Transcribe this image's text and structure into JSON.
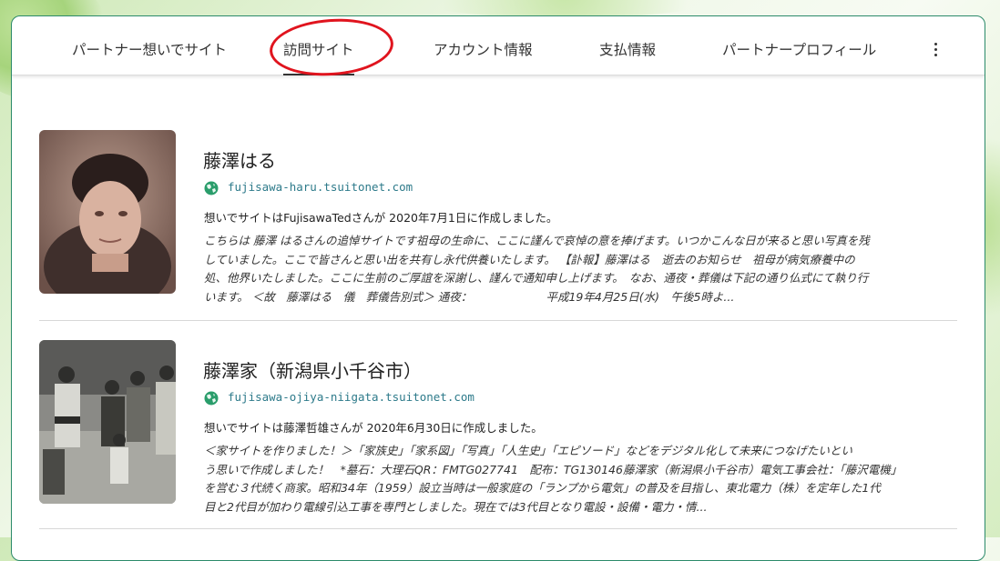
{
  "nav": {
    "tabs": [
      {
        "label": "パートナー想いでサイト"
      },
      {
        "label": "訪問サイト"
      },
      {
        "label": "アカウント情報"
      },
      {
        "label": "支払情報"
      },
      {
        "label": "パートナープロフィール"
      }
    ],
    "active_index": 1
  },
  "entries": [
    {
      "name": "藤澤はる",
      "url": "fujisawa-haru.tsuitonet.com",
      "meta": "想いでサイトはFujisawaTedさんが 2020年7月1日に作成しました。",
      "desc": [
        "こちらは 藤澤 はるさんの追悼サイトです祖母の生命に、ここに謹んで哀悼の意を捧げます。いつかこんな日が来ると思い写真を残",
        "していました。ここで皆さんと思い出を共有し永代供養いたします。 【訃報】藤澤はる　逝去のお知らせ　祖母が病気療養中の",
        "処、他界いたしました。ここに生前のご厚誼を深謝し、謹んで通知申し上げます。　なお、通夜・葬儀は下記の通り仏式にて執り行",
        "います。 ＜故　藤澤はる　儀　葬儀告別式＞ 通夜：　　　　　　　平成19年4月25日(水)　午後5時よ..."
      ]
    },
    {
      "name": "藤澤家（新潟県小千谷市）",
      "url": "fujisawa-ojiya-niigata.tsuitonet.com",
      "meta": "想いでサイトは藤澤哲雄さんが 2020年6月30日に作成しました。",
      "desc": [
        "＜家サイトを作りました！＞「家族史」「家系図」「写真」「人生史」「エピソード」などをデジタル化して未来につなげたいとい",
        "う思いで作成しました！　*墓石：大理石QR：FMTG027741　配布：TG130146藤澤家（新潟県小千谷市）電気工事会社：「藤沢電機」",
        "を営む３代続く商家。昭和34年（1959）設立当時は一般家庭の「ランプから電気」の普及を目指し、東北電力（株）を定年した1代",
        "目と2代目が加わり電線引込工事を専門としました。現在では3代目となり電設・設備・電力・情..."
      ]
    }
  ],
  "colors": {
    "accent_border": "#2b8a6a",
    "url_text": "#2d7a8a",
    "annotation_circle": "#e0141e"
  },
  "icons": {
    "more": "more-vert-icon",
    "globe": "globe-icon"
  }
}
